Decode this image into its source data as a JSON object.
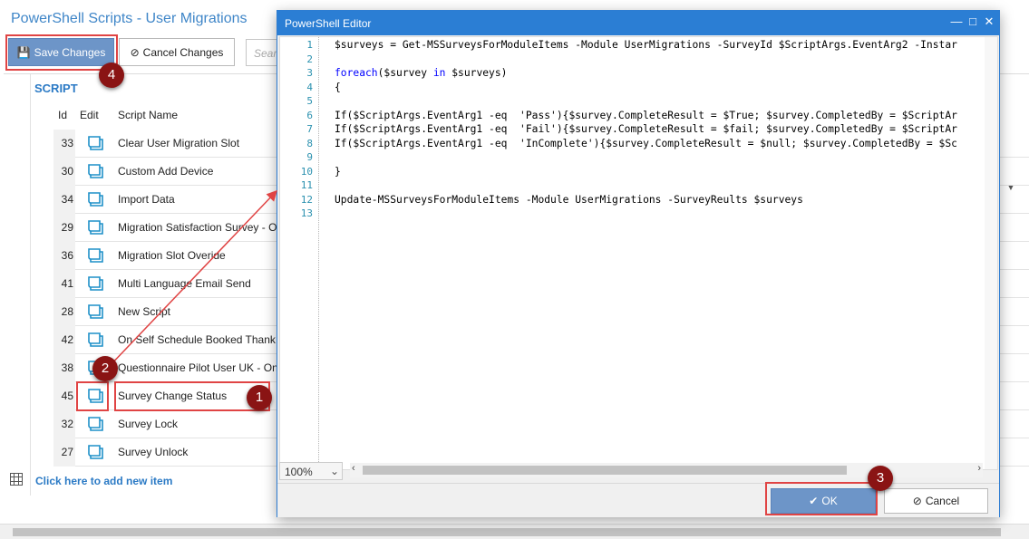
{
  "app": {
    "title": "PowerShell Scripts - User Migrations"
  },
  "toolbar": {
    "save_label": "Save Changes",
    "cancel_label": "Cancel Changes",
    "search_placeholder": "Search"
  },
  "grid": {
    "section_title": "SCRIPT",
    "columns": [
      "Id",
      "Edit",
      "Script Name"
    ],
    "rows": [
      {
        "id": "33",
        "name": "Clear User Migration Slot"
      },
      {
        "id": "30",
        "name": "Custom Add Device"
      },
      {
        "id": "34",
        "name": "Import Data"
      },
      {
        "id": "29",
        "name": "Migration Satisfaction Survey - O"
      },
      {
        "id": "36",
        "name": "Migration Slot Overide"
      },
      {
        "id": "41",
        "name": "Multi Language Email Send"
      },
      {
        "id": "28",
        "name": "New Script"
      },
      {
        "id": "42",
        "name": "On Self Schedule Booked Thank Y"
      },
      {
        "id": "38",
        "name": "Questionnaire Pilot User UK - On"
      },
      {
        "id": "45",
        "name": "Survey Change Status"
      },
      {
        "id": "32",
        "name": "Survey Lock"
      },
      {
        "id": "27",
        "name": "Survey Unlock"
      }
    ],
    "add_item_label": "Click here to add new item"
  },
  "dialog": {
    "title": "PowerShell Editor",
    "line_numbers": [
      "1",
      "2",
      "3",
      "4",
      "5",
      "6",
      "7",
      "8",
      "9",
      "10",
      "11",
      "12",
      "13"
    ],
    "code_lines": [
      "$surveys = Get-MSSurveysForModuleItems -Module UserMigrations -SurveyId $ScriptArgs.EventArg2 -Instar",
      "",
      "foreach($survey in $surveys)",
      "{",
      "",
      "If($ScriptArgs.EventArg1 -eq  'Pass'){$survey.CompleteResult = $True; $survey.CompletedBy = $ScriptAr",
      "If($ScriptArgs.EventArg1 -eq  'Fail'){$survey.CompleteResult = $fail; $survey.CompletedBy = $ScriptAr",
      "If($ScriptArgs.EventArg1 -eq  'InComplete'){$survey.CompleteResult = $null; $survey.CompletedBy = $Sc",
      "",
      "}",
      "",
      "Update-MSSurveysForModuleItems -Module UserMigrations -SurveyReults $surveys",
      ""
    ],
    "zoom": "100%",
    "ok_label": "OK",
    "cancel_label": "Cancel"
  },
  "annotations": [
    "1",
    "2",
    "3",
    "4"
  ],
  "colors": {
    "accent": "#2b7ed4",
    "highlight": "#e04444",
    "badge": "#8a1414"
  }
}
